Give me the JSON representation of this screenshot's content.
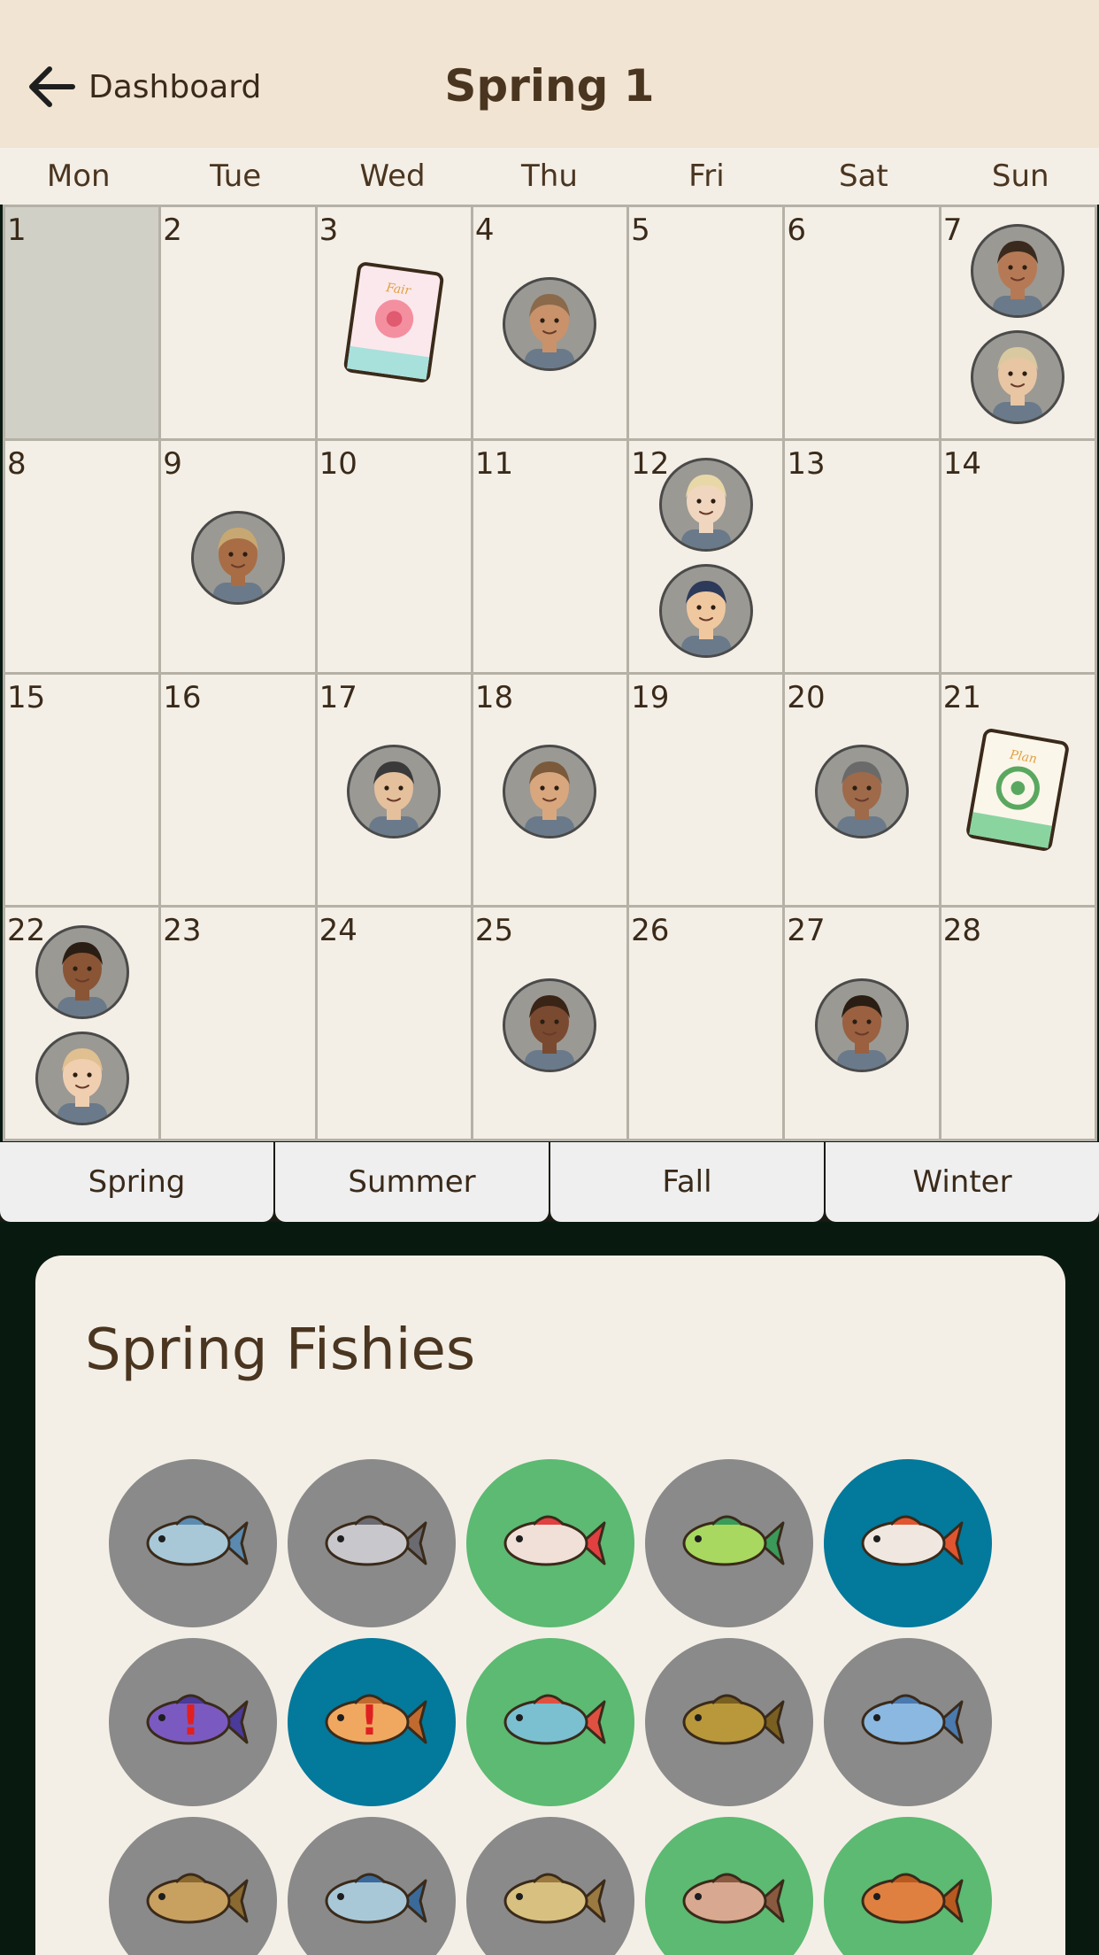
{
  "header": {
    "back_label": "Dashboard",
    "title": "Spring 1"
  },
  "weekdays": [
    "Mon",
    "Tue",
    "Wed",
    "Thu",
    "Fri",
    "Sat",
    "Sun"
  ],
  "days": [
    {
      "n": "1",
      "today": true,
      "items": []
    },
    {
      "n": "2",
      "items": []
    },
    {
      "n": "3",
      "items": [
        {
          "type": "card",
          "icon": "flower-festival-card-icon"
        }
      ]
    },
    {
      "n": "4",
      "items": [
        {
          "type": "avatar",
          "icon": "villager-birthday-avatar",
          "skin": "#c9926a",
          "hair": "#8a6a4a"
        }
      ]
    },
    {
      "n": "5",
      "items": []
    },
    {
      "n": "6",
      "items": []
    },
    {
      "n": "7",
      "items": [
        {
          "type": "avatar",
          "icon": "villager-birthday-avatar",
          "skin": "#b57a55",
          "hair": "#3a2a1e"
        },
        {
          "type": "avatar",
          "icon": "villager-birthday-avatar",
          "skin": "#e8c5a3",
          "hair": "#d9c9a0"
        }
      ]
    },
    {
      "n": "8",
      "items": []
    },
    {
      "n": "9",
      "items": [
        {
          "type": "avatar",
          "icon": "villager-birthday-avatar",
          "skin": "#a86d45",
          "hair": "#c8a872"
        }
      ]
    },
    {
      "n": "10",
      "items": []
    },
    {
      "n": "11",
      "items": []
    },
    {
      "n": "12",
      "items": [
        {
          "type": "avatar",
          "icon": "villager-birthday-avatar",
          "skin": "#f0d6bf",
          "hair": "#e8d8a8"
        },
        {
          "type": "avatar",
          "icon": "villager-birthday-avatar",
          "skin": "#f0c8a0",
          "hair": "#2e3a5a"
        }
      ]
    },
    {
      "n": "13",
      "items": []
    },
    {
      "n": "14",
      "items": []
    },
    {
      "n": "15",
      "items": []
    },
    {
      "n": "16",
      "items": []
    },
    {
      "n": "17",
      "items": [
        {
          "type": "avatar",
          "icon": "villager-birthday-avatar",
          "skin": "#e5c09c",
          "hair": "#3a3a3a"
        }
      ]
    },
    {
      "n": "18",
      "items": [
        {
          "type": "avatar",
          "icon": "villager-birthday-avatar",
          "skin": "#d9a77e",
          "hair": "#7a5a3a"
        }
      ]
    },
    {
      "n": "19",
      "items": []
    },
    {
      "n": "20",
      "items": [
        {
          "type": "avatar",
          "icon": "villager-birthday-avatar",
          "skin": "#9e6a4a",
          "hair": "#6a6a6a"
        }
      ]
    },
    {
      "n": "21",
      "items": [
        {
          "type": "card",
          "icon": "plant-festival-card-icon"
        }
      ]
    },
    {
      "n": "22",
      "items": [
        {
          "type": "avatar",
          "icon": "villager-birthday-avatar",
          "skin": "#8a5535",
          "hair": "#2a1e14"
        },
        {
          "type": "avatar",
          "icon": "villager-birthday-avatar",
          "skin": "#f0cfb0",
          "hair": "#e0c090"
        }
      ]
    },
    {
      "n": "23",
      "items": []
    },
    {
      "n": "24",
      "items": []
    },
    {
      "n": "25",
      "items": [
        {
          "type": "avatar",
          "icon": "villager-birthday-avatar",
          "skin": "#7a4a30",
          "hair": "#3a2416"
        }
      ]
    },
    {
      "n": "26",
      "items": []
    },
    {
      "n": "27",
      "items": [
        {
          "type": "avatar",
          "icon": "villager-birthday-avatar",
          "skin": "#9a6040",
          "hair": "#2a1e14"
        }
      ]
    },
    {
      "n": "28",
      "items": []
    }
  ],
  "season_tabs": [
    "Spring",
    "Summer",
    "Fall",
    "Winter"
  ],
  "fish_panel": {
    "title": "Spring Fishies",
    "fish": [
      {
        "icon": "tuna-fish-icon",
        "bg": "#8a8a8a",
        "body": "#a8c8d8",
        "fin": "#5a8ab0"
      },
      {
        "icon": "catfish-fish-icon",
        "bg": "#8a8a8a",
        "body": "#c8c8cc",
        "fin": "#6a6a70"
      },
      {
        "icon": "flowerhorn-fish-icon",
        "bg": "#5cba72",
        "body": "#f0e0d8",
        "fin": "#e04040"
      },
      {
        "icon": "bluegill-fish-icon",
        "bg": "#8a8a8a",
        "body": "#a8d860",
        "fin": "#3a9a5a"
      },
      {
        "icon": "koi-fish-icon",
        "bg": "#03799c",
        "body": "#f0e8e0",
        "fin": "#e05530"
      },
      {
        "icon": "betta-fish-icon",
        "bg": "#8a8a8a",
        "body": "#7a5ac0",
        "fin": "#4a3a9a",
        "alert": "!"
      },
      {
        "icon": "loach-fish-icon",
        "bg": "#03799c",
        "body": "#f0a860",
        "fin": "#c06a30",
        "alert": "!"
      },
      {
        "icon": "rainbow-fish-icon",
        "bg": "#5cba72",
        "body": "#7ac0d0",
        "fin": "#e05040"
      },
      {
        "icon": "crayfish-icon",
        "bg": "#8a8a8a",
        "body": "#b8983a",
        "fin": "#7a6020"
      },
      {
        "icon": "eel-fish-icon",
        "bg": "#8a8a8a",
        "body": "#8ab8e0",
        "fin": "#4a7ab0"
      },
      {
        "icon": "perch-fish-icon",
        "bg": "#8a8a8a",
        "body": "#c8a060",
        "fin": "#8a6a30"
      },
      {
        "icon": "striped-fish-icon",
        "bg": "#8a8a8a",
        "body": "#a8c8d8",
        "fin": "#3a6a9a"
      },
      {
        "icon": "trout-fish-icon",
        "bg": "#8a8a8a",
        "body": "#d8c080",
        "fin": "#9a7a40"
      },
      {
        "icon": "snapper-fish-icon",
        "bg": "#5cba72",
        "body": "#d8a890",
        "fin": "#8a5a40"
      },
      {
        "icon": "goby-fish-icon",
        "bg": "#5cba72",
        "body": "#e08040",
        "fin": "#b85a20"
      }
    ]
  }
}
